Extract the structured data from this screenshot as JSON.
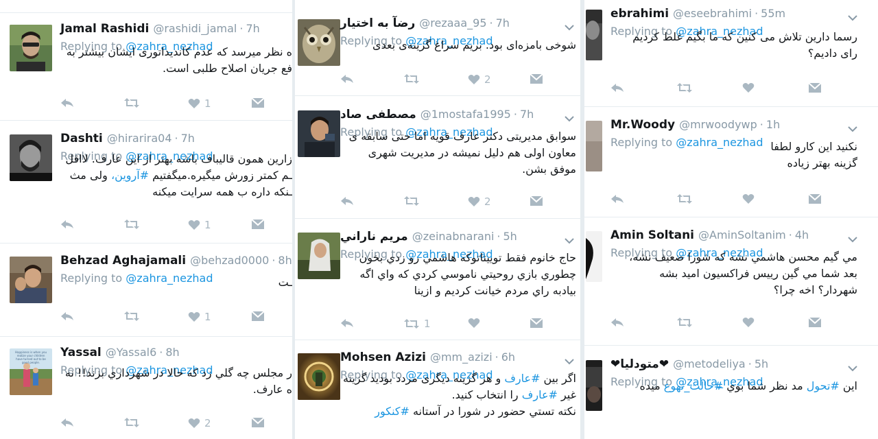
{
  "reply_prefix": "Replying to",
  "left": [
    {
      "name": "Jamal Rashidi",
      "handle": "@rashidi_jamal",
      "time": "7h",
      "mention": "@zahra_nezhad",
      "lines": [
        "ه نظر میرسد که عدم کاندیداتوری ایشان بیشتر به",
        "فع جریان اصلاح طلبی است."
      ],
      "likes": "1"
    },
    {
      "name": "Dashti",
      "handle": "@hirarira04",
      "time": "7h",
      "mention": "@zahra_nezhad",
      "lines": [
        "زارین همون قالیباف باشه بهتر از این عارف. لااقل",
        "ـم کمتر زورش میگیره.میگفتیم #آروین، ولی مث",
        "ـنکه داره ب همه سرایت میکنه"
      ],
      "likes": "1"
    },
    {
      "name": "Behzad Aghajamali",
      "handle": "@behzad0000",
      "time": "8h",
      "mention": "@zahra_nezhad",
      "lines": [
        "ـت"
      ],
      "likes": "1"
    },
    {
      "name": "Yassal",
      "handle": "@Yassal6",
      "time": "8h",
      "mention": "@zahra_nezhad",
      "lines": [
        "ر مجلس چه گلي زد که حالا در شهرداري بزند!! نه",
        "ه عارف."
      ],
      "likes": "2",
      "avatar_text": "Happiness is when you realize your children have turned out to be good people."
    }
  ],
  "mid": [
    {
      "name": "رضآ به اختیار",
      "handle": "@rezaaa_95",
      "time": "7h",
      "mention": "@zahra_nezhad",
      "lines": [
        "شوخی بامزه‌ای بود. بریم سراغ گزینه‌ی بعدی"
      ],
      "likes": "2"
    },
    {
      "name": "مصطفی صاد",
      "handle": "@1mostafa1995",
      "time": "7h",
      "mention": "@zahra_nezhad",
      "lines": [
        "سوابق مدیریتی دکتر عارف قویه اما حتی سابقه ی",
        "معاون اولی هم دلیل نمیشه در مدیریت شهری",
        "موفق بشن."
      ],
      "likes": "2"
    },
    {
      "name": "مريم ناراني",
      "handle": "@zeinabnarani",
      "time": "5h",
      "mention": "@zahra_nezhad",
      "lines": [
        "حاج خانوم فقط توييتاتوكه هاشمي رو زدي بخون",
        "چطوري بازي روحيتي ناموسي كردي كه واي اگه",
        "بيادبه راي مردم خيانت كرديم و ازينا"
      ],
      "retweets": "1"
    },
    {
      "name": "Mohsen Azizi",
      "handle": "@mm_azizi",
      "time": "6h",
      "mention": "@zahra_nezhad",
      "lines": [
        "اگر بین #عارف و هر گزینه دیگری مردد بودید گزینه",
        "غیر #عارف را انتخاب کنید.",
        "نکته تستي حضور در شورا در آستانه #کنکور"
      ]
    }
  ],
  "right": [
    {
      "name": "ebrahimi",
      "handle": "@eseebrahimi",
      "time": "55m",
      "mention": "@zahra_nezhad",
      "lines": [
        "رسما دارین تلاش می کنین که ما بگیم غلط کردیم",
        "رای دادیم؟"
      ]
    },
    {
      "name": "Mr.Woody",
      "handle": "@mrwoodywp",
      "time": "1h",
      "mention": "@zahra_nezhad",
      "lines": [
        "نکنید این کارو لطفا",
        "گزینه بهتر زیاده"
      ]
    },
    {
      "name": "Amin Soltani",
      "handle": "@AminSoltanim",
      "time": "4h",
      "mention": "@zahra_nezhad",
      "lines": [
        "مي گيم محسن هاشمي نشه كه شورا ضعيف نشه،",
        "بعد شما مي گين رييس فراكسيون اميد بشه",
        "شهردار؟ اخه چرا؟"
      ]
    },
    {
      "name": "❤متودلیا❤",
      "handle": "@metodeliya",
      "time": "5h",
      "mention": "@zahra_nezhad",
      "lines": [
        "این #تحول مد نظر شما بوي #حالت_تهوع ميده"
      ]
    }
  ],
  "colors": {
    "mention": "#1b95e0",
    "muted": "#8899a6",
    "icon": "#aab8c2",
    "heart": "#e0245e"
  },
  "icons": [
    "reply-icon",
    "retweet-icon",
    "like-icon",
    "direct-message-icon",
    "chevron-down-icon"
  ]
}
